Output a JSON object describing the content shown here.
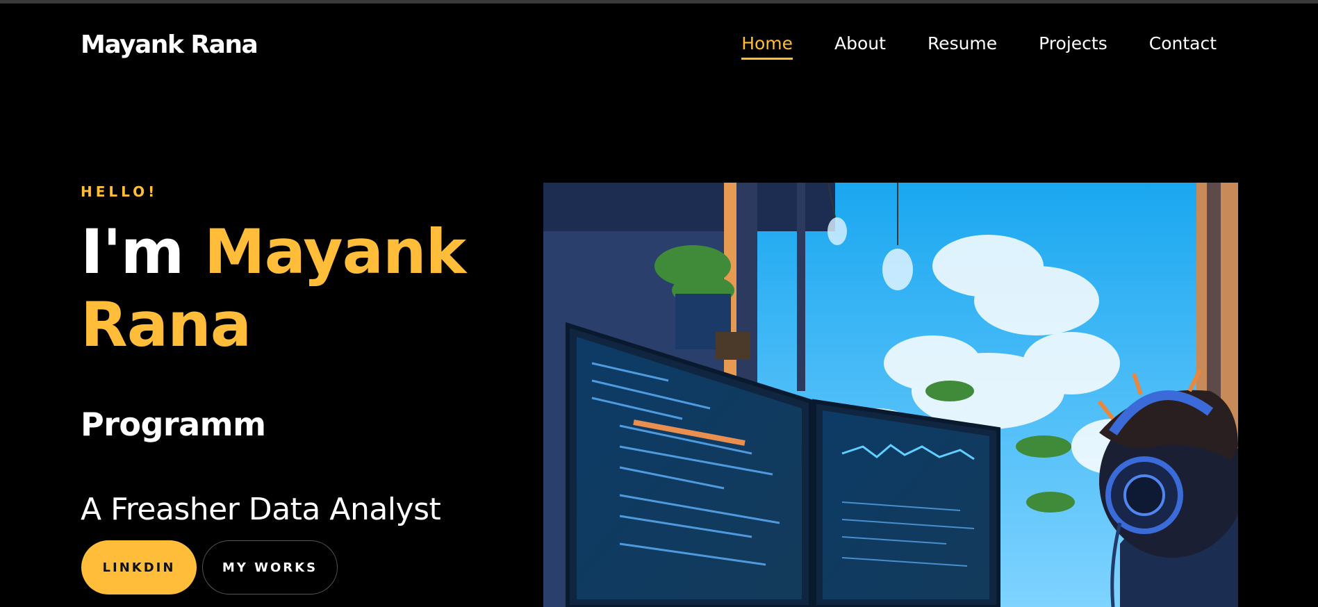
{
  "brand": {
    "name": "Mayank Rana"
  },
  "nav": {
    "items": [
      {
        "label": "Home",
        "active": true
      },
      {
        "label": "About",
        "active": false
      },
      {
        "label": "Resume",
        "active": false
      },
      {
        "label": "Projects",
        "active": false
      },
      {
        "label": "Contact",
        "active": false
      }
    ]
  },
  "hero": {
    "greeting": "HELLO!",
    "intro": "I'm",
    "name_first": "Mayank",
    "name_last": "Rana",
    "role": "Programm",
    "tagline": "A Freasher Data Analyst",
    "buttons": {
      "primary": "LINKDIN",
      "secondary": "MY WORKS"
    },
    "image_alt": "Illustration of a programmer with headphones working at multiple monitors near a window"
  },
  "colors": {
    "accent": "#ffbd39",
    "background": "#000000",
    "text": "#ffffff"
  }
}
